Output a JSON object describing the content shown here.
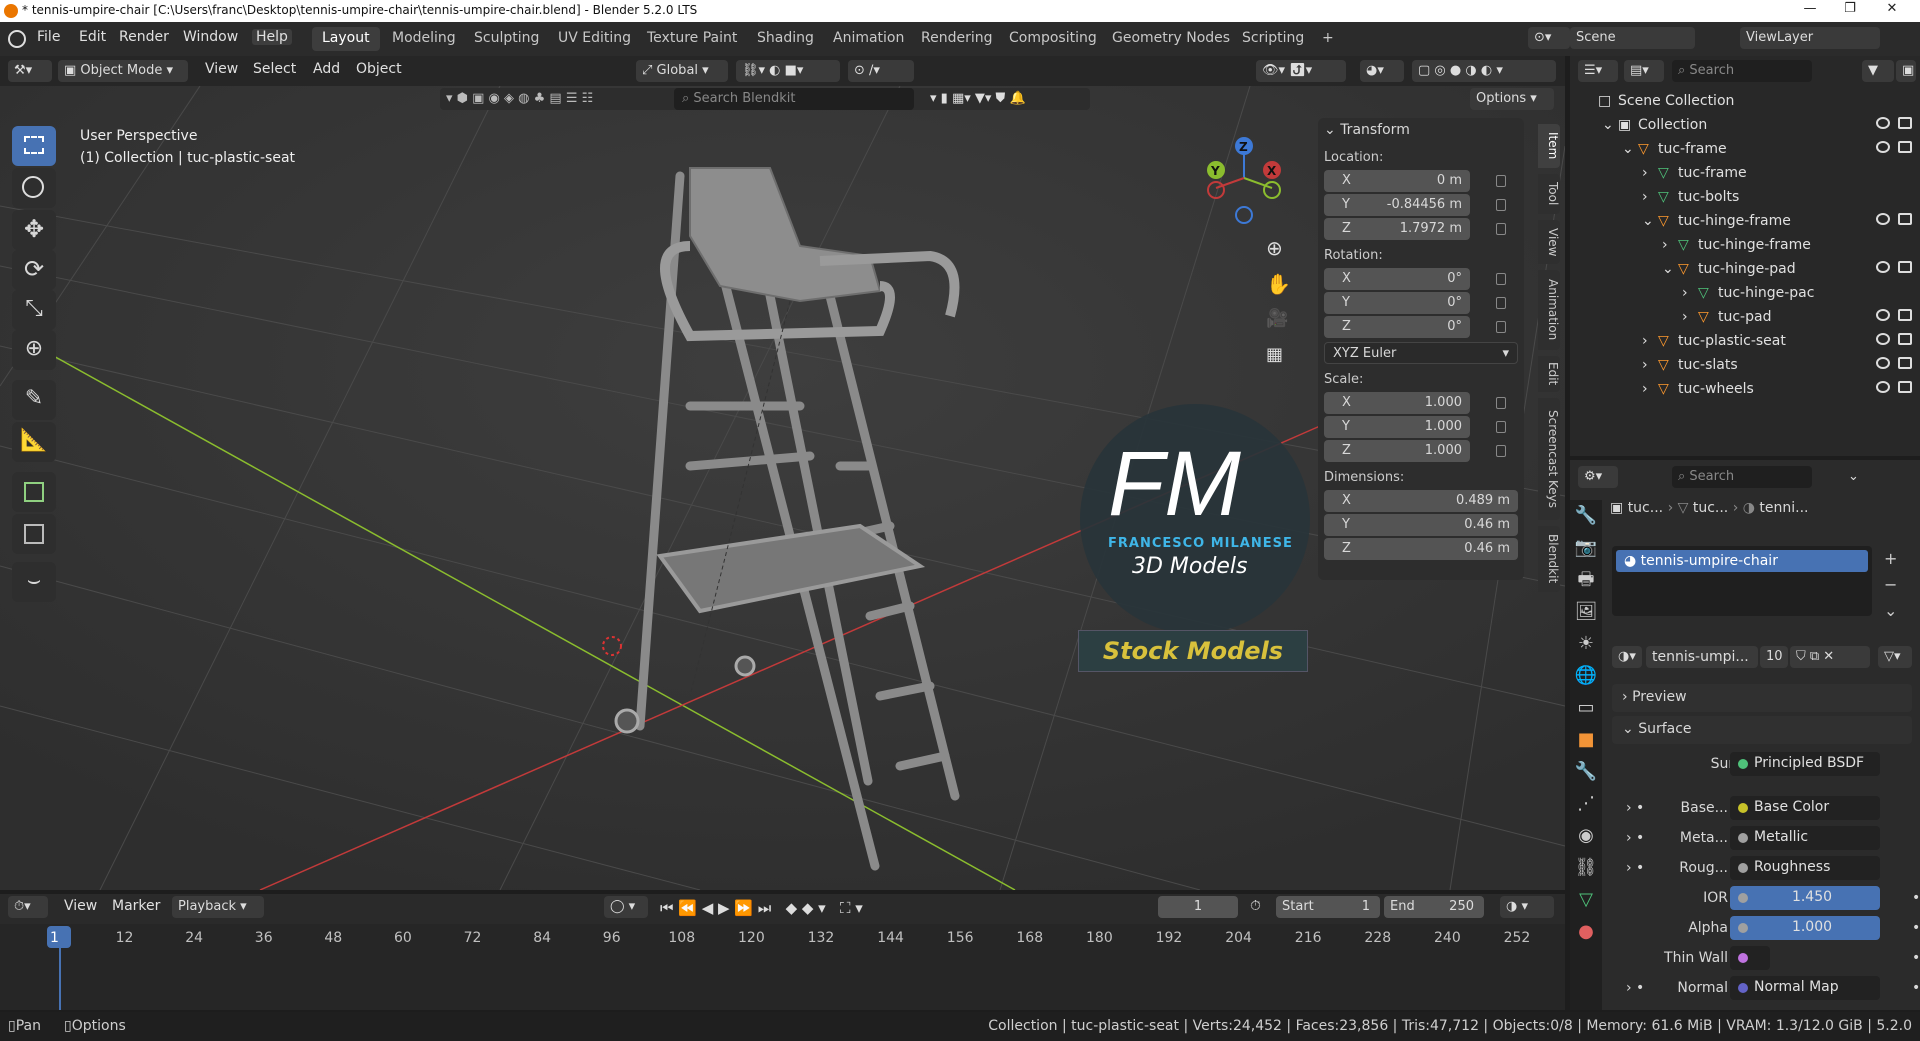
{
  "window": {
    "title": "* tennis-umpire-chair [C:\\Users\\franc\\Desktop\\tennis-umpire-chair\\tennis-umpire-chair.blend] - Blender 5.2.0 LTS",
    "min": "—",
    "max": "❐",
    "close": "✕"
  },
  "menu": [
    "File",
    "Edit",
    "Render",
    "Window",
    "Help"
  ],
  "workspaces": [
    "Layout",
    "Modeling",
    "Sculpting",
    "UV Editing",
    "Texture Paint",
    "Shading",
    "Animation",
    "Rendering",
    "Compositing",
    "Geometry Nodes",
    "Scripting",
    "+"
  ],
  "scene_label": "Scene",
  "viewlayer_label": "ViewLayer",
  "viewport_header": {
    "mode": "Object Mode",
    "items": [
      "View",
      "Select",
      "Add",
      "Object"
    ],
    "orientation": "Global",
    "search_placeholder": "Search Blendkit",
    "options": "Options"
  },
  "viewport": {
    "perspective": "User Perspective",
    "collection": "(1) Collection | tuc-plastic-seat",
    "watermark_big": "FM",
    "watermark_sub1": "FRANCESCO MILANESE",
    "watermark_sub2": "3D Models",
    "watermark_banner": "Stock Models",
    "gizmo": {
      "z": "Z",
      "y": "Y",
      "x": "X"
    }
  },
  "transform": {
    "title": "Transform",
    "location_label": "Location:",
    "location": [
      {
        "axis": "X",
        "value": "0 m"
      },
      {
        "axis": "Y",
        "value": "-0.84456 m"
      },
      {
        "axis": "Z",
        "value": "1.7972 m"
      }
    ],
    "rotation_label": "Rotation:",
    "rotation": [
      {
        "axis": "X",
        "value": "0°"
      },
      {
        "axis": "Y",
        "value": "0°"
      },
      {
        "axis": "Z",
        "value": "0°"
      }
    ],
    "rotation_mode": "XYZ Euler",
    "scale_label": "Scale:",
    "scale": [
      {
        "axis": "X",
        "value": "1.000"
      },
      {
        "axis": "Y",
        "value": "1.000"
      },
      {
        "axis": "Z",
        "value": "1.000"
      }
    ],
    "dimensions_label": "Dimensions:",
    "dimensions": [
      {
        "axis": "X",
        "value": "0.489 m"
      },
      {
        "axis": "Y",
        "value": "0.46 m"
      },
      {
        "axis": "Z",
        "value": "0.46 m"
      }
    ]
  },
  "side_tabs": [
    "Item",
    "Tool",
    "View",
    "Animation",
    "Edit",
    "Screencast Keys",
    "Blendkit"
  ],
  "outliner": {
    "search_placeholder": "Search",
    "rows": [
      {
        "label": "Scene Collection",
        "indent": 0
      },
      {
        "label": "Collection",
        "indent": 1
      },
      {
        "label": "tuc-frame",
        "indent": 2
      },
      {
        "label": "tuc-frame",
        "indent": 3
      },
      {
        "label": "tuc-bolts",
        "indent": 3
      },
      {
        "label": "tuc-hinge-frame",
        "indent": 3
      },
      {
        "label": "tuc-hinge-frame",
        "indent": 4
      },
      {
        "label": "tuc-hinge-pad",
        "indent": 4
      },
      {
        "label": "tuc-hinge-pac",
        "indent": 5
      },
      {
        "label": "tuc-pad",
        "indent": 5
      },
      {
        "label": "tuc-plastic-seat",
        "indent": 3
      },
      {
        "label": "tuc-slats",
        "indent": 3
      },
      {
        "label": "tuc-wheels",
        "indent": 3
      }
    ]
  },
  "properties": {
    "search_placeholder": "Search",
    "breadcrumb": [
      "tuc...",
      "tuc...",
      "tenni..."
    ],
    "material_slot": "tennis-umpire-chair",
    "material_name": "tennis-umpi...",
    "users": "10",
    "preview": "Preview",
    "surface_panel": "Surface",
    "surface_label": "Surface",
    "surface_value": "Principled BSDF",
    "inputs": [
      {
        "label": "Base...",
        "value": "Base Color",
        "color": "#c7c229"
      },
      {
        "label": "Meta...",
        "value": "Metallic",
        "color": "#a0a0a0"
      },
      {
        "label": "Roug...",
        "value": "Roughness",
        "color": "#a0a0a0"
      },
      {
        "label": "IOR",
        "value": "1.450",
        "color": "#a0a0a0"
      },
      {
        "label": "Alpha",
        "value": "1.000",
        "color": "#a0a0a0"
      },
      {
        "label": "Thin Wall",
        "value": "",
        "color": "#c073e0"
      },
      {
        "label": "Normal",
        "value": "Normal Map",
        "color": "#6363c7"
      }
    ]
  },
  "timeline": {
    "items": [
      "View",
      "Marker",
      "Playback"
    ],
    "current_frame": "1",
    "start_label": "Start",
    "start": "1",
    "end_label": "End",
    "end": "250",
    "ticks": [
      "1",
      "12",
      "24",
      "36",
      "48",
      "60",
      "72",
      "84",
      "96",
      "108",
      "120",
      "132",
      "144",
      "156",
      "168",
      "180",
      "192",
      "204",
      "216",
      "228",
      "240",
      "252"
    ]
  },
  "status": {
    "left1": "Pan",
    "left2": "Options",
    "right": "Collection | tuc-plastic-seat | Verts:24,452 | Faces:23,856 | Tris:47,712 | Objects:0/8 | Memory: 61.6 MiB | VRAM: 1.3/12.0 GiB | 5.2.0"
  },
  "colors": {
    "accent": "#4772b3",
    "object_orange": "#ff9a2e",
    "mesh_green": "#4fc27a",
    "banner_gold": "#d8c13c"
  }
}
